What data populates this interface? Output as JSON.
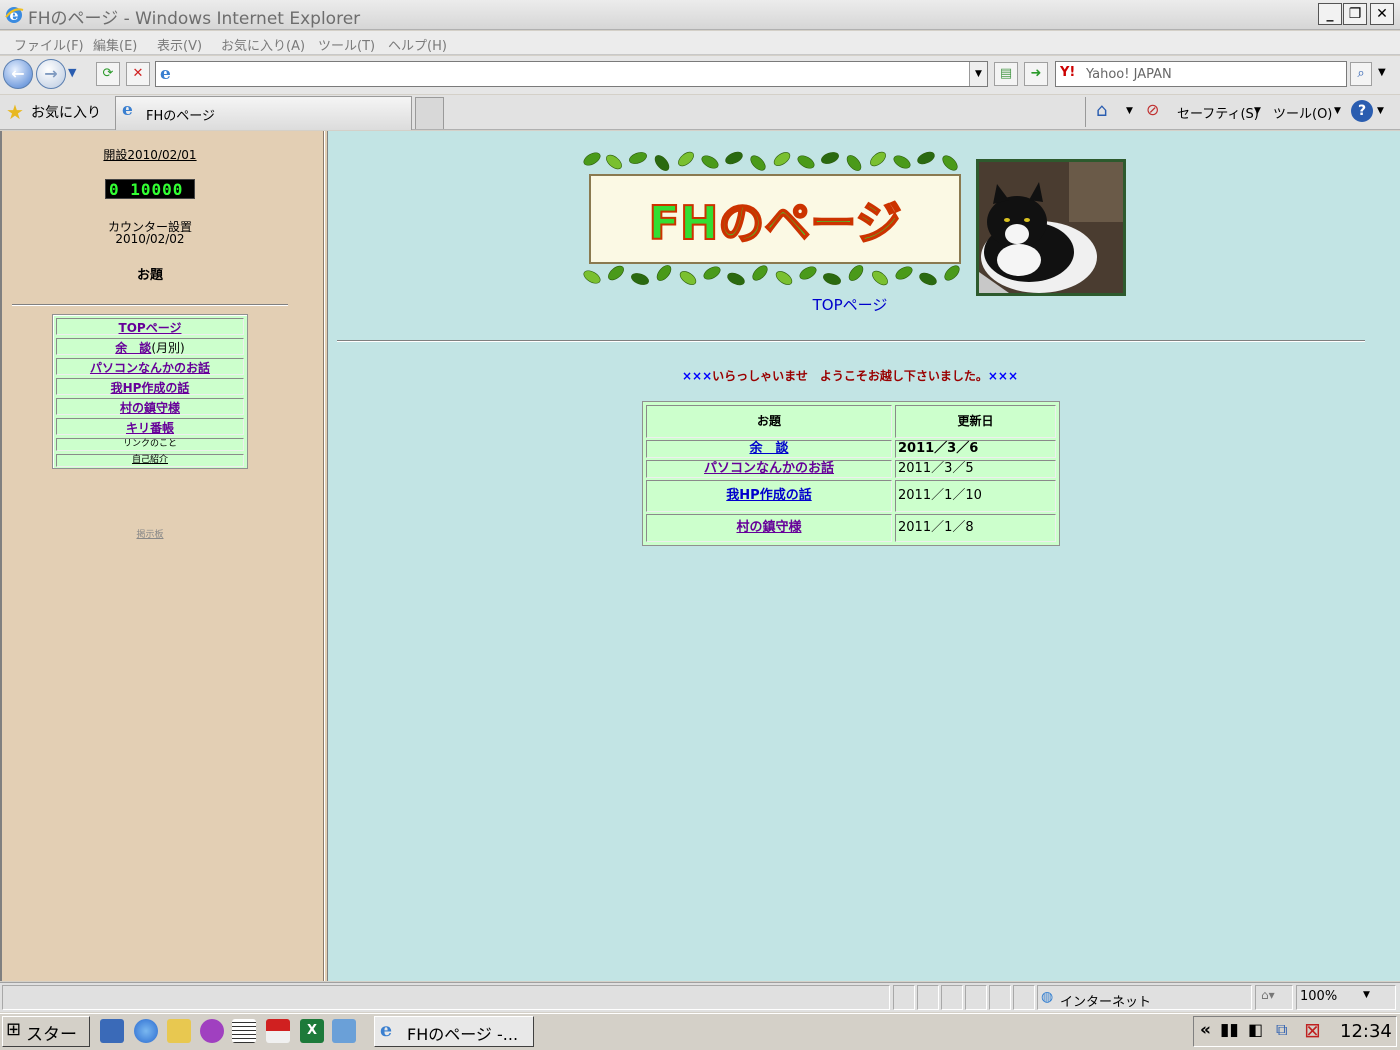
{
  "window": {
    "title": "FHのページ - Windows Internet Explorer"
  },
  "menubar": {
    "items": [
      "ファイル(F)",
      "編集(E)",
      "表示(V)",
      "お気に入り(A)",
      "ツール(T)",
      "ヘルプ(H)"
    ]
  },
  "addressbar": {
    "url": "",
    "search_placeholder": "Yahoo! JAPAN"
  },
  "favorites": {
    "label": "お気に入り",
    "tab_title": "FHのページ",
    "safety_label": "セーフティ(S)",
    "tools_label": "ツール(O)"
  },
  "left": {
    "opened": "開設2010/02/01",
    "counter": "0 10000",
    "counter_label": "カウンター設置",
    "counter_date": "2010/02/02",
    "topics_heading": "お題",
    "menu": [
      "TOPページ",
      "余　談",
      "(月別)",
      "パソコンなんかのお話",
      "我HP作成の話",
      "村の鎮守様",
      "キリ番帳",
      "リンクのこと",
      "自己紹介"
    ],
    "bbs": "掲示板"
  },
  "main": {
    "banner_text": "FHのページ",
    "top_link": "TOPページ",
    "welcome_marks_left": "×××",
    "welcome": "いらっしゃいませ　ようこそお越し下さいました。",
    "welcome_marks_right": "×××",
    "table": {
      "headers": [
        "お題",
        "更新日"
      ],
      "rows": [
        {
          "topic": "余　談",
          "date": "2011／3／6"
        },
        {
          "topic": "パソコンなんかのお話",
          "date": "2011／3／5"
        },
        {
          "topic": "我HP作成の話",
          "date": "2011／1／10"
        },
        {
          "topic": "村の鎮守様",
          "date": "2011／1／8"
        }
      ]
    }
  },
  "statusbar": {
    "zone": "インターネット",
    "zoom": "100%"
  },
  "taskbar": {
    "start": "スタート",
    "task_ie": "FHのページ -...",
    "clock": "12:34"
  },
  "colors": {
    "left_bg": "#e3cfb4",
    "right_bg": "#c2e4e4",
    "table_bg": "#ccffcc",
    "link_purple": "#660099",
    "link_blue": "#0000cc",
    "welcome_red": "#990000"
  }
}
